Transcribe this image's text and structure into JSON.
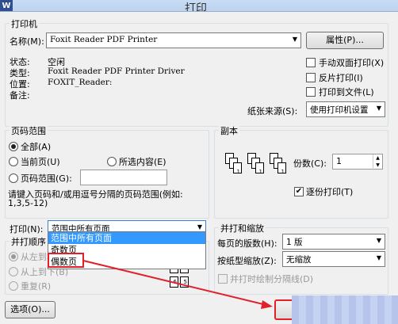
{
  "window": {
    "title": "打印",
    "app_icon": "W"
  },
  "printer": {
    "group_label": "打印机",
    "name_label": "名称(M):",
    "name_value": "Foxit Reader PDF Printer",
    "properties_button": "属性(P)...",
    "status_label": "状态:",
    "status_value": "空闲",
    "type_label": "类型:",
    "type_value": "Foxit Reader PDF Printer Driver",
    "location_label": "位置:",
    "location_value": "FOXIT_Reader:",
    "comment_label": "备注:",
    "manual_duplex_label": "手动双面打印(X)",
    "reverse_print_label": "反片打印(I)",
    "print_to_file_label": "打印到文件(L)",
    "paper_source_label": "纸张来源(S):",
    "paper_source_value": "使用打印机设置"
  },
  "page_range": {
    "group_label": "页码范围",
    "all_label": "全部(A)",
    "current_label": "当前页(U)",
    "selection_label": "所选内容(E)",
    "pages_label": "页码范围(G):",
    "pages_value": "",
    "hint": "请键入页码和/或用逗号分隔的页码范围(例如:",
    "hint_example": "1,3,5-12)"
  },
  "copies": {
    "group_label": "副本",
    "count_label": "份数(C):",
    "count_value": "1",
    "collate_label": "逐份打印(T)",
    "collate_checked": true,
    "collate_pages": [
      "3",
      "2",
      "1"
    ]
  },
  "print_what": {
    "label": "打印(N):",
    "value": "范围中所有页面",
    "options": [
      "范围中所有页面",
      "奇数页",
      "偶数页"
    ]
  },
  "print_order": {
    "group_label": "并打顺序",
    "left_to_right_label": "从左到右",
    "top_to_bottom_label": "从上到下(B)",
    "repeat_label": "重复(R)",
    "preview_pages": [
      "2",
      "4",
      "6",
      "5"
    ]
  },
  "zoom": {
    "group_label": "并打和缩放",
    "pages_per_sheet_label": "每页的版数(H):",
    "pages_per_sheet_value": "1 版",
    "scale_label": "按纸型缩放(Z):",
    "scale_value": "无缩放",
    "draw_borders_label": "并打时绘制分隔线(D)"
  },
  "footer": {
    "options_button": "选项(O)..."
  },
  "colors": {
    "highlight_box": "#e0202a",
    "arrow": "#e0202a",
    "selection": "#3399ff"
  }
}
